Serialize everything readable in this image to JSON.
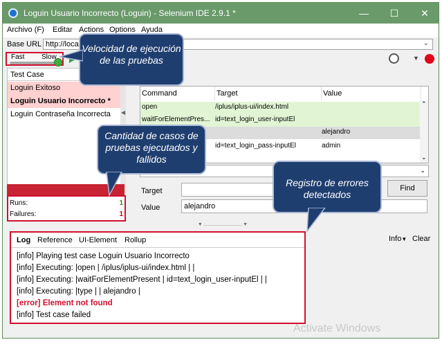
{
  "window": {
    "title": "Loguin Usuario Incorrecto (Loguin) - Selenium IDE 2.9.1 *"
  },
  "menu": [
    "Archivo (F)",
    "Editar",
    "Actions",
    "Options",
    "Ayuda"
  ],
  "base_url": {
    "label": "Base URL",
    "value": "http://loca"
  },
  "speed": {
    "fast_label": "Fast",
    "slow_label": "Slow"
  },
  "test_cases": {
    "header": "Test Case",
    "items": [
      {
        "label": "Loguin Exitoso"
      },
      {
        "label": "Loguin Usuario Incorrecto *"
      },
      {
        "label": "Loguin Contraseña Incorrecta"
      }
    ]
  },
  "stats": {
    "runs_label": "Runs:",
    "runs_value": "1",
    "failures_label": "Failures:",
    "failures_value": "1"
  },
  "table": {
    "headers": [
      "Command",
      "Target",
      "Value"
    ],
    "rows": [
      {
        "command": "open",
        "target": "/iplus/iplus-ui/index.html",
        "value": ""
      },
      {
        "command": "waitForElementPres...",
        "target": "id=text_login_user-inputEl",
        "value": ""
      },
      {
        "command": "",
        "target": "",
        "value": "alejandro"
      },
      {
        "command": "",
        "target": "id=text_login_pass-inputEl",
        "value": "admin"
      }
    ]
  },
  "editor": {
    "target_label": "Target",
    "target_value": "",
    "value_label": "Value",
    "value_value": "alejandro",
    "find_label": "Find"
  },
  "log": {
    "tabs": [
      "Log",
      "Reference",
      "UI-Element",
      "Rollup"
    ],
    "info_label": "Info",
    "clear_label": "Clear",
    "lines": [
      "[info] Playing test case Loguin Usuario Incorrecto",
      "[info] Executing: |open | /iplus/iplus-ui/index.html | |",
      "[info] Executing: |waitForElementPresent | id=text_login_user-inputEl | |",
      "[info] Executing: |type | | alejandro |",
      "[error] Element  not found",
      "[info] Test case failed"
    ]
  },
  "callouts": {
    "speed": "Velocidad de ejecución de las pruebas",
    "count": "Cantidad de casos de pruebas ejecutados y fallidos",
    "errors": "Registro de errores detectados"
  },
  "watermark": "Activate Windows",
  "colors": {
    "highlight": "#d10f2e",
    "callout_fill": "#1f3e70",
    "titlebar": "#6a9a6a",
    "pass_row": "#e1f5d4",
    "fail_row": "#ffd1d1"
  }
}
